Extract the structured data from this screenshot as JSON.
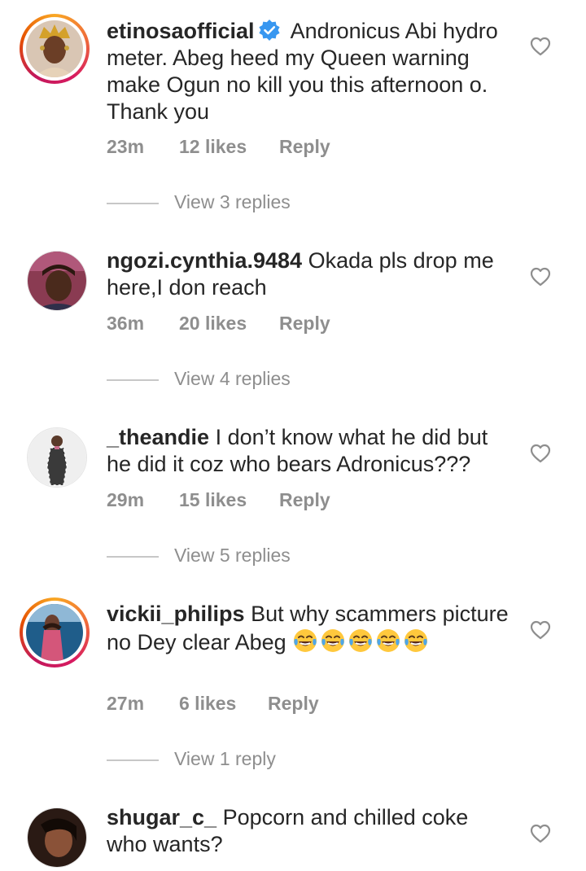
{
  "comments": [
    {
      "username": "etinosaofficial",
      "verified": true,
      "text": "Andronicus Abi hydro meter. Abeg heed my Queen warning make Ogun no kill you this afternoon o. Thank you",
      "time": "23m",
      "likes": "12 likes",
      "reply": "Reply",
      "view_replies": "View 3 replies",
      "avatar_icon": "profile-photo-icon",
      "has_story_ring": true
    },
    {
      "username": "ngozi.cynthia.9484",
      "verified": false,
      "text": "Okada pls drop me here,I don reach",
      "time": "36m",
      "likes": "20 likes",
      "reply": "Reply",
      "view_replies": "View 4 replies",
      "avatar_icon": "profile-photo-icon",
      "has_story_ring": false
    },
    {
      "username": "_theandie",
      "verified": false,
      "text": "I don’t know what he did but he did it coz who bears Adronicus???",
      "time": "29m",
      "likes": "15 likes",
      "reply": "Reply",
      "view_replies": "View 5 replies",
      "avatar_icon": "profile-photo-icon",
      "has_story_ring": false
    },
    {
      "username": "vickii_philips",
      "verified": false,
      "text": "But why scammers picture no Dey clear Abeg",
      "emoji": "😂😂😂😂😂",
      "time": "27m",
      "likes": "6 likes",
      "reply": "Reply",
      "view_replies": "View 1 reply",
      "avatar_icon": "profile-photo-icon",
      "has_story_ring": true
    },
    {
      "username": "shugar_c_",
      "verified": false,
      "text": "Popcorn and chilled coke who wants?",
      "avatar_icon": "profile-photo-icon",
      "has_story_ring": false
    }
  ],
  "icons": {
    "like": "heart-outline-icon",
    "verified": "verified-badge-icon",
    "emoji": "tears-of-joy-emoji"
  },
  "colors": {
    "text": "#262626",
    "muted": "#8e8e8e",
    "verified": "#3897f0",
    "divider": "#c7c7c7"
  }
}
